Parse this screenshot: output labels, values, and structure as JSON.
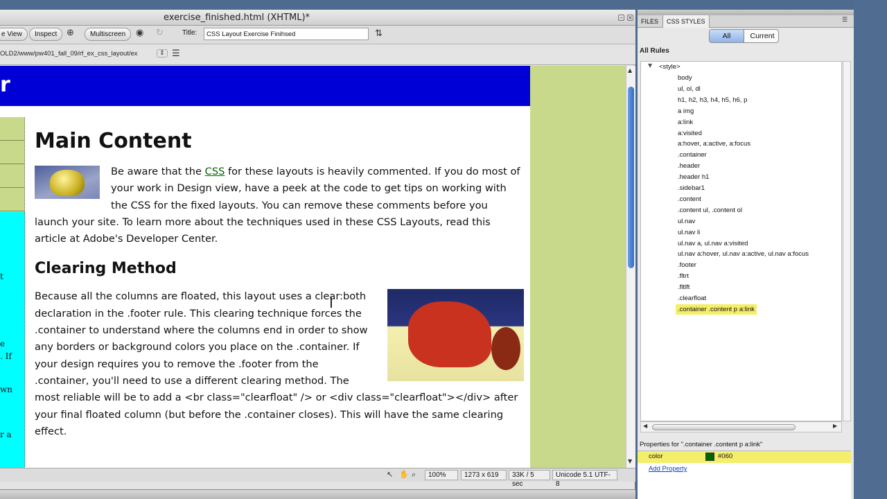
{
  "window": {
    "title": "exercise_finished.html (XHTML)*"
  },
  "toolbar": {
    "view_label": "e View",
    "inspect_label": "Inspect",
    "multiscreen_label": "Multiscreen",
    "title_label": "Title:",
    "title_value": "CSS Layout Exercise Finihsed"
  },
  "address": {
    "path": "OLD2/www/pw401_fall_09/rf_ex_css_layout/ex"
  },
  "page": {
    "header_fragment": "r",
    "sidebar_fragments": [
      "t",
      "e",
      ". If",
      "wn",
      "r a"
    ],
    "main_heading": "Main Content",
    "p1_before_link": "Be aware that the ",
    "p1_link": "CSS",
    "p1_after_link": " for these layouts is heavily commented. If you do most of your work in Design view, have a peek at the code to get tips on working with the CSS for the fixed layouts. You can remove these comments before you launch your site. To learn more about the techniques used in these CSS Layouts, read this article at Adobe's Developer Center.",
    "section_heading": "Clearing Method",
    "p2": "Because all the columns are floated, this layout uses a clear:both declaration in the .footer rule. This clearing technique forces the .container to understand where the columns end in order to show any borders or background colors you place on the .container. If your design requires you to remove the .footer from the .container, you'll need to use a different clearing method. The most reliable will be to add a <br class=\"clearfloat\" /> or <div class=\"clearfloat\"></div> after your final floated column (but before the .container closes). This will have the same clearing effect."
  },
  "status": {
    "zoom": "100%",
    "size": "1273 x 619",
    "download": "33K / 5 sec",
    "encoding": "Unicode 5.1 UTF-8"
  },
  "panel": {
    "tab_files": "FILES",
    "tab_css": "CSS STYLES",
    "seg_all": "All",
    "seg_current": "Current",
    "all_rules_label": "All Rules",
    "style_root": "<style>",
    "rules": [
      "body",
      "ul, ol, dl",
      "h1, h2, h3, h4, h5, h6, p",
      "a img",
      "a:link",
      "a:visited",
      "a:hover, a:active, a:focus",
      ".container",
      ".header",
      ".header h1",
      ".sidebar1",
      ".content",
      ".content ul, .content ol",
      "ul.nav",
      "ul.nav li",
      "ul.nav a, ul.nav a:visited",
      "ul.nav a:hover, ul.nav a:active, ul.nav a:focus",
      ".footer",
      ".fltrt",
      ".fltlft",
      ".clearfloat",
      ".container .content p a:link"
    ],
    "selected_rule_index": 21,
    "properties_heading": "Properties for \".container .content p a:link\"",
    "prop_name": "color",
    "prop_value": "#060",
    "prop_color": "#006600",
    "add_property": "Add Property"
  },
  "colors": {
    "header_blue": "#0000d6",
    "sidebar_green": "#c8d98c",
    "sidebar_cyan": "#00ffff",
    "link_green": "#006600",
    "selection_yellow": "#f4ef6a"
  }
}
